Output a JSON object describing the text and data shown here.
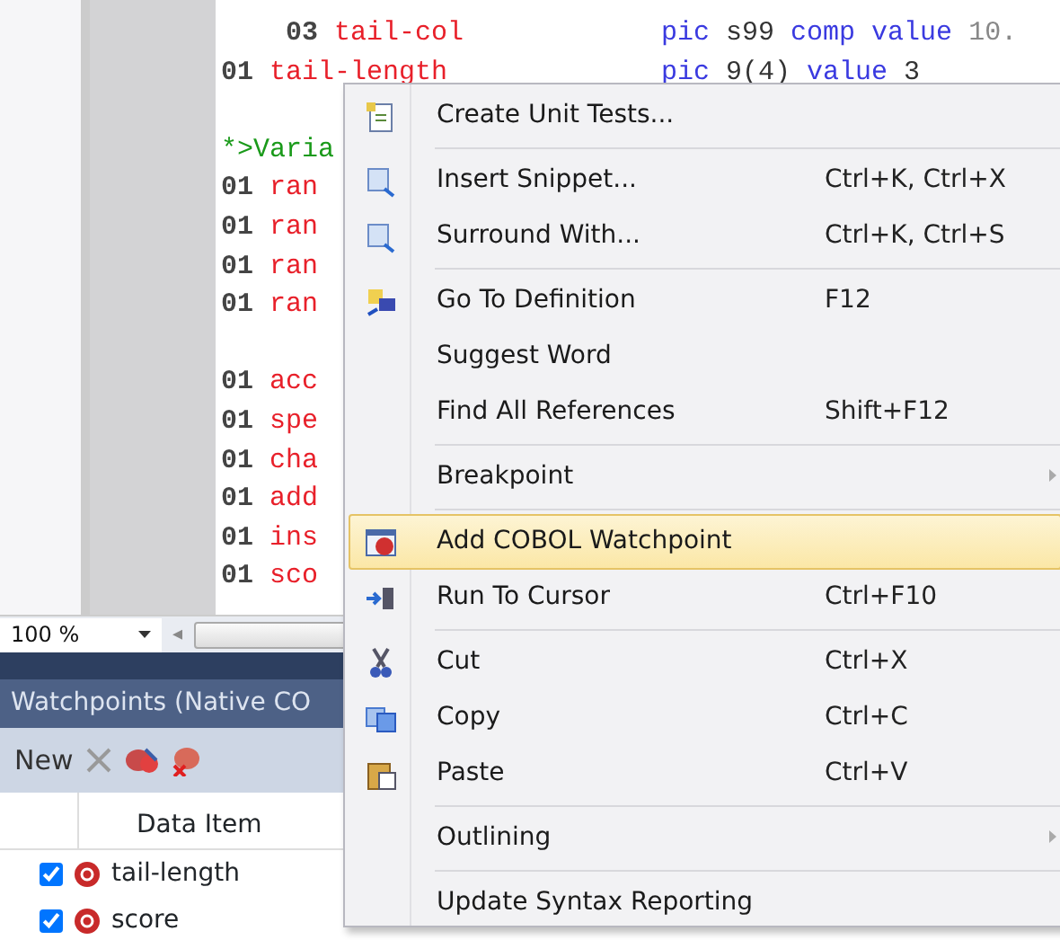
{
  "editor": {
    "lines": [
      {
        "indented": true,
        "segments": [
          {
            "kind": "number",
            "text": "03"
          },
          {
            "kind": "name",
            "text": "tail-col"
          }
        ],
        "clause": [
          {
            "kind": "keyword",
            "text": "pic"
          },
          {
            "kind": "plain",
            "text": "s99"
          },
          {
            "kind": "keyword",
            "text": "comp"
          },
          {
            "kind": "keyword",
            "text": "value"
          },
          {
            "kind": "literal",
            "text": "10."
          }
        ]
      },
      {
        "indented": false,
        "segments": [
          {
            "kind": "number",
            "text": "01"
          },
          {
            "kind": "name",
            "text": "tail-length"
          }
        ],
        "clause": [
          {
            "kind": "keyword",
            "text": "pic"
          },
          {
            "kind": "plain",
            "text": "9(4)"
          },
          {
            "kind": "keyword",
            "text": "value"
          },
          {
            "kind": "plain",
            "text": "3"
          }
        ]
      },
      {
        "kind": "blank"
      },
      {
        "indented": false,
        "segments": [
          {
            "kind": "comment",
            "text": "*>Varia"
          }
        ]
      },
      {
        "indented": false,
        "segments": [
          {
            "kind": "number",
            "text": "01"
          },
          {
            "kind": "name",
            "text": "ran"
          }
        ]
      },
      {
        "indented": false,
        "segments": [
          {
            "kind": "number",
            "text": "01"
          },
          {
            "kind": "name",
            "text": "ran"
          }
        ]
      },
      {
        "indented": false,
        "segments": [
          {
            "kind": "number",
            "text": "01"
          },
          {
            "kind": "name",
            "text": "ran"
          }
        ]
      },
      {
        "indented": false,
        "segments": [
          {
            "kind": "number",
            "text": "01"
          },
          {
            "kind": "name",
            "text": "ran"
          }
        ]
      },
      {
        "kind": "blank"
      },
      {
        "indented": false,
        "segments": [
          {
            "kind": "number",
            "text": "01"
          },
          {
            "kind": "name",
            "text": "acc"
          }
        ]
      },
      {
        "indented": false,
        "segments": [
          {
            "kind": "number",
            "text": "01"
          },
          {
            "kind": "name",
            "text": "spe"
          }
        ]
      },
      {
        "indented": false,
        "segments": [
          {
            "kind": "number",
            "text": "01"
          },
          {
            "kind": "name",
            "text": "cha"
          }
        ]
      },
      {
        "indented": false,
        "segments": [
          {
            "kind": "number",
            "text": "01"
          },
          {
            "kind": "name",
            "text": "add"
          }
        ]
      },
      {
        "indented": false,
        "segments": [
          {
            "kind": "number",
            "text": "01"
          },
          {
            "kind": "name",
            "text": "ins"
          }
        ]
      },
      {
        "indented": false,
        "segments": [
          {
            "kind": "number",
            "text": "01"
          },
          {
            "kind": "name",
            "text": "sco"
          }
        ]
      }
    ]
  },
  "zoom": {
    "value": "100 %",
    "arrow": "◂"
  },
  "watchpoints": {
    "title": "Watchpoints (Native CO",
    "toolbar": {
      "new_label": "New"
    },
    "columns": [
      "Data Item"
    ],
    "rows": [
      {
        "name": "tail-length",
        "checked": true
      },
      {
        "name": "score",
        "checked": true
      }
    ]
  },
  "context_menu": {
    "items": [
      {
        "kind": "item",
        "label": "Create Unit Tests...",
        "selected": false,
        "submenu": false
      },
      {
        "kind": "separator"
      },
      {
        "kind": "item",
        "label": "Insert Snippet...",
        "shortcut": "Ctrl+K, Ctrl+X",
        "selected": false,
        "submenu": false
      },
      {
        "kind": "item",
        "label": "Surround With...",
        "shortcut": "Ctrl+K, Ctrl+S",
        "selected": false,
        "submenu": false
      },
      {
        "kind": "separator"
      },
      {
        "kind": "item",
        "label": "Go To Definition",
        "shortcut": "F12",
        "selected": false,
        "submenu": false
      },
      {
        "kind": "item",
        "label": "Suggest Word",
        "selected": false,
        "submenu": false
      },
      {
        "kind": "item",
        "label": "Find All References",
        "shortcut": "Shift+F12",
        "selected": false,
        "submenu": false
      },
      {
        "kind": "separator"
      },
      {
        "kind": "item",
        "label": "Breakpoint",
        "selected": false,
        "submenu": true
      },
      {
        "kind": "separator"
      },
      {
        "kind": "item",
        "label": "Add COBOL Watchpoint",
        "selected": true,
        "submenu": false
      },
      {
        "kind": "item",
        "label": "Run To Cursor",
        "shortcut": "Ctrl+F10",
        "selected": false,
        "submenu": false
      },
      {
        "kind": "separator"
      },
      {
        "kind": "item",
        "label": "Cut",
        "shortcut": "Ctrl+X",
        "selected": false,
        "submenu": false
      },
      {
        "kind": "item",
        "label": "Copy",
        "shortcut": "Ctrl+C",
        "selected": false,
        "submenu": false
      },
      {
        "kind": "item",
        "label": "Paste",
        "shortcut": "Ctrl+V",
        "selected": false,
        "submenu": false
      },
      {
        "kind": "separator"
      },
      {
        "kind": "item",
        "label": "Outlining",
        "selected": false,
        "submenu": true
      },
      {
        "kind": "separator"
      },
      {
        "kind": "item",
        "label": "Update Syntax Reporting",
        "selected": false,
        "submenu": false
      }
    ]
  }
}
